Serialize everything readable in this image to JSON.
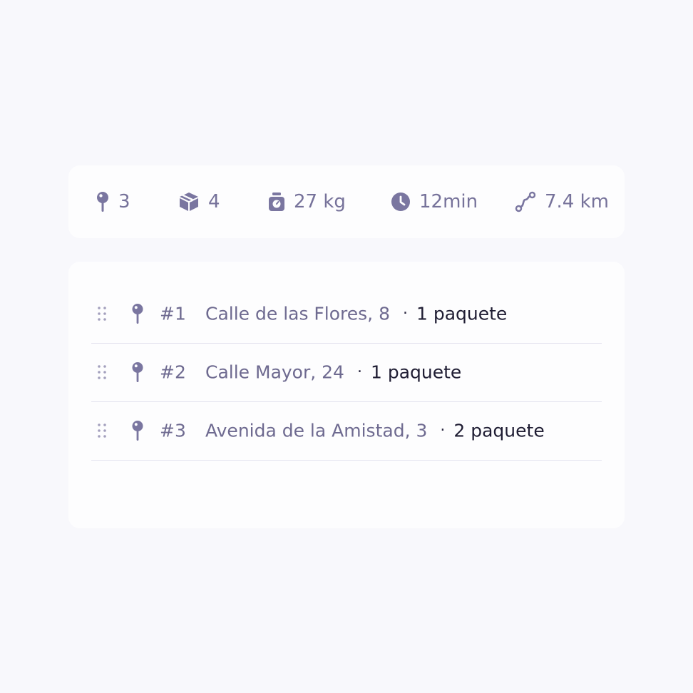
{
  "summary": {
    "stops": "3",
    "packages": "4",
    "weight": "27 kg",
    "time": "12min",
    "distance": "7.4 km"
  },
  "stops": [
    {
      "number": "#1",
      "address": "Calle de las Flores, 8",
      "separator": "·",
      "packages": "1 paquete"
    },
    {
      "number": "#2",
      "address": "Calle Mayor, 24",
      "separator": "·",
      "packages": "1 paquete"
    },
    {
      "number": "#3",
      "address": "Avenida de la Amistad, 3",
      "separator": "·",
      "packages": "2 paquete"
    }
  ],
  "colors": {
    "icon": "#7a76a0",
    "text_muted": "#6e6a90",
    "text_dark": "#1f1d33",
    "divider": "#e3e2ef",
    "background": "#f8f8fc",
    "card": "#fdfdfe"
  },
  "icons": [
    "map-pin-icon",
    "package-icon",
    "scale-icon",
    "clock-icon",
    "route-icon",
    "drag-handle-icon"
  ]
}
